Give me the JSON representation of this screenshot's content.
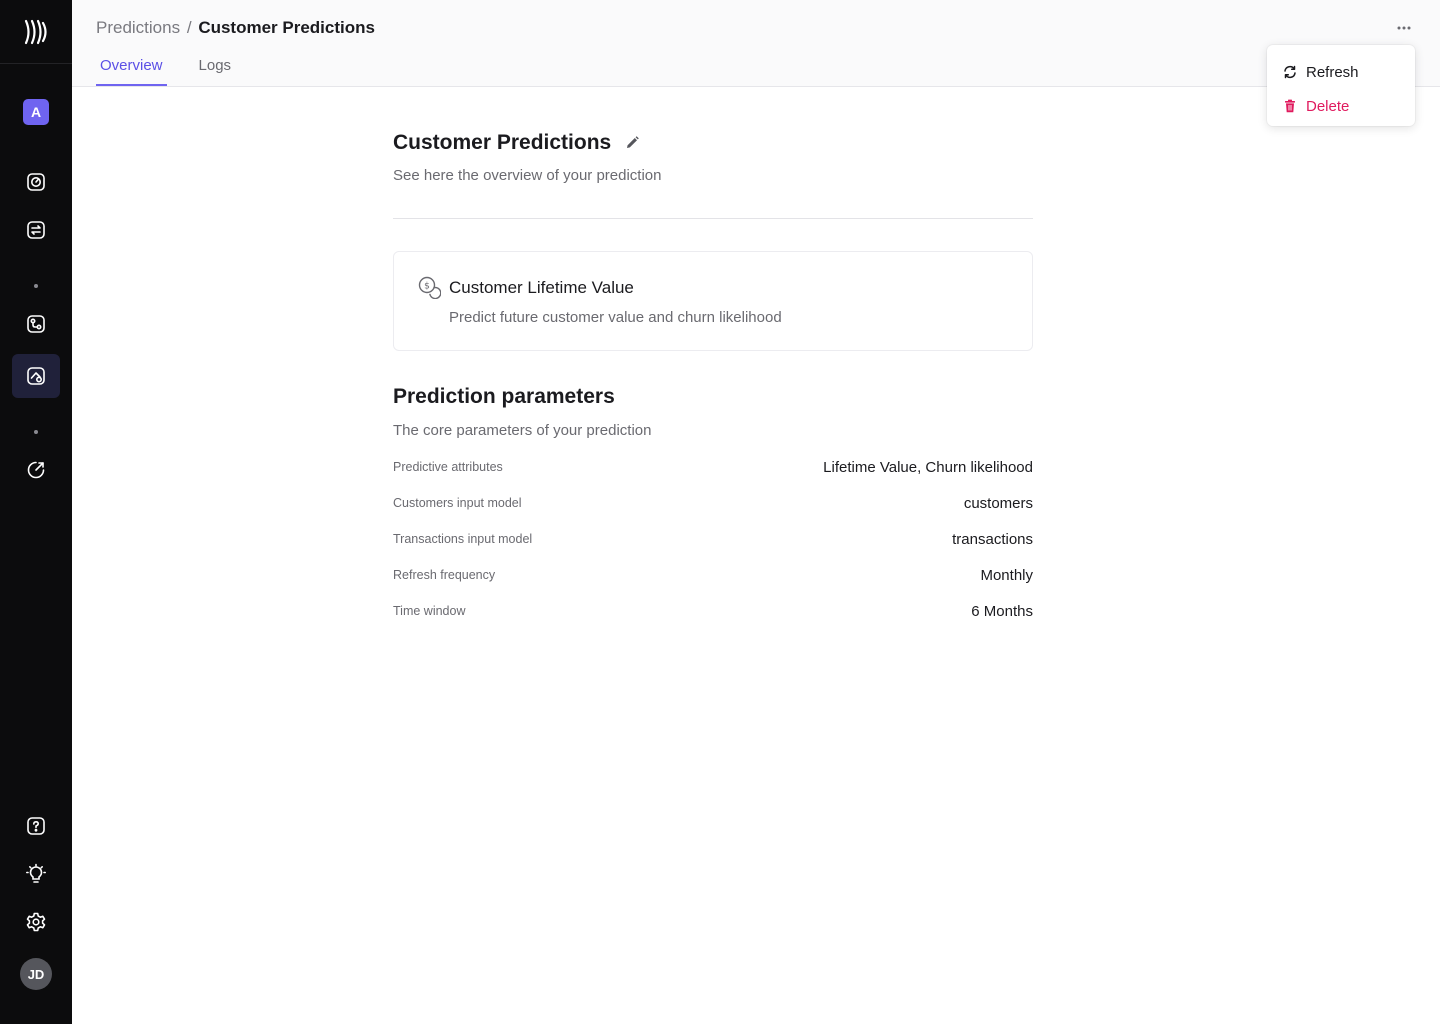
{
  "sidebar": {
    "logo": "brand-logo-icon",
    "workspace_initial": "A",
    "nav_items": [
      {
        "name": "dashboard",
        "icon": "gauge-icon"
      },
      {
        "name": "syncs",
        "icon": "sync-icon"
      },
      {
        "name": "flows",
        "icon": "flow-icon"
      },
      {
        "name": "predictions",
        "icon": "predictions-icon",
        "active": true
      },
      {
        "name": "activity",
        "icon": "activity-icon"
      }
    ],
    "bottom_items": [
      {
        "name": "help",
        "icon": "help-icon"
      },
      {
        "name": "ideas",
        "icon": "lightbulb-icon"
      },
      {
        "name": "settings",
        "icon": "gear-icon"
      }
    ],
    "user_initials": "JD"
  },
  "header": {
    "breadcrumb_parent": "Predictions",
    "breadcrumb_separator": "/",
    "breadcrumb_current": "Customer Predictions",
    "tabs": [
      {
        "label": "Overview",
        "active": true
      },
      {
        "label": "Logs",
        "active": false
      }
    ]
  },
  "menu": {
    "refresh_label": "Refresh",
    "delete_label": "Delete",
    "delete_color": "#e01a5e"
  },
  "main": {
    "title": "Customer Predictions",
    "subtitle": "See here the overview of your prediction",
    "model": {
      "title": "Customer Lifetime Value",
      "description": "Predict future customer value and churn likelihood",
      "icon": "coins-icon"
    },
    "params_title": "Prediction parameters",
    "params_subtitle": "The core parameters of your prediction",
    "params": [
      {
        "label": "Predictive attributes",
        "value": "Lifetime Value, Churn likelihood"
      },
      {
        "label": "Customers input model",
        "value": "customers"
      },
      {
        "label": "Transactions input model",
        "value": "transactions"
      },
      {
        "label": "Refresh frequency",
        "value": "Monthly"
      },
      {
        "label": "Time window",
        "value": "6 Months"
      }
    ]
  },
  "colors": {
    "accent": "#6f64f0",
    "sidebar_bg": "#0c0c0d",
    "active_nav_bg": "#20213a"
  }
}
